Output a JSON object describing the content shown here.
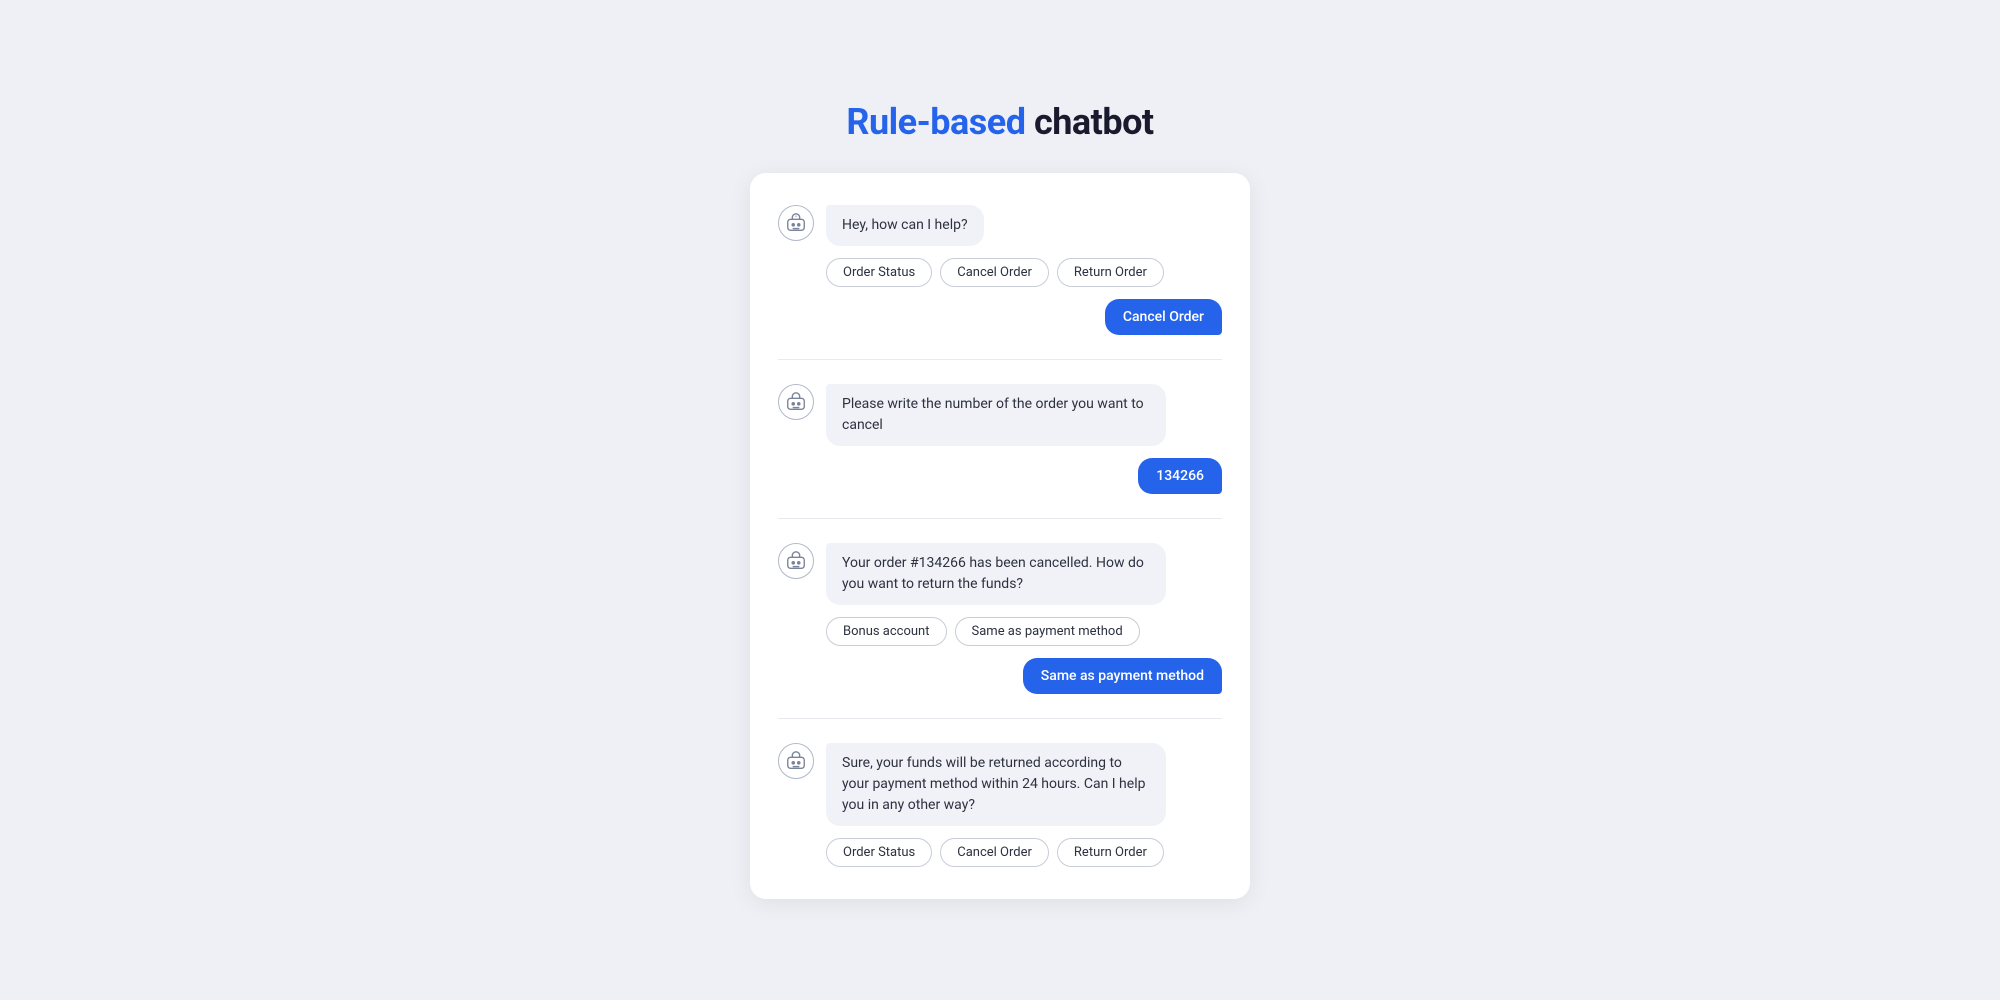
{
  "header": {
    "title_highlight": "Rule-based",
    "title_normal": "chatbot"
  },
  "chat": {
    "messages": [
      {
        "id": "greet",
        "type": "bot",
        "text": "Hey, how can I help?",
        "options": [
          "Order Status",
          "Cancel Order",
          "Return Order"
        ]
      },
      {
        "id": "user-cancel",
        "type": "user",
        "text": "Cancel Order"
      },
      {
        "id": "ask-order-number",
        "type": "bot",
        "text": "Please write the number of the order you want to cancel",
        "options": []
      },
      {
        "id": "user-order-number",
        "type": "user",
        "text": "134266"
      },
      {
        "id": "cancelled",
        "type": "bot",
        "text": "Your order #134266 has been cancelled. How do you want to return the funds?",
        "options": [
          "Bonus account",
          "Same as payment method"
        ]
      },
      {
        "id": "user-refund",
        "type": "user",
        "text": "Same as payment method"
      },
      {
        "id": "confirm",
        "type": "bot",
        "text": "Sure, your funds will be returned according to your payment method within 24 hours. Can I help you in any other way?",
        "options": [
          "Order Status",
          "Cancel Order",
          "Return Order"
        ]
      }
    ]
  }
}
